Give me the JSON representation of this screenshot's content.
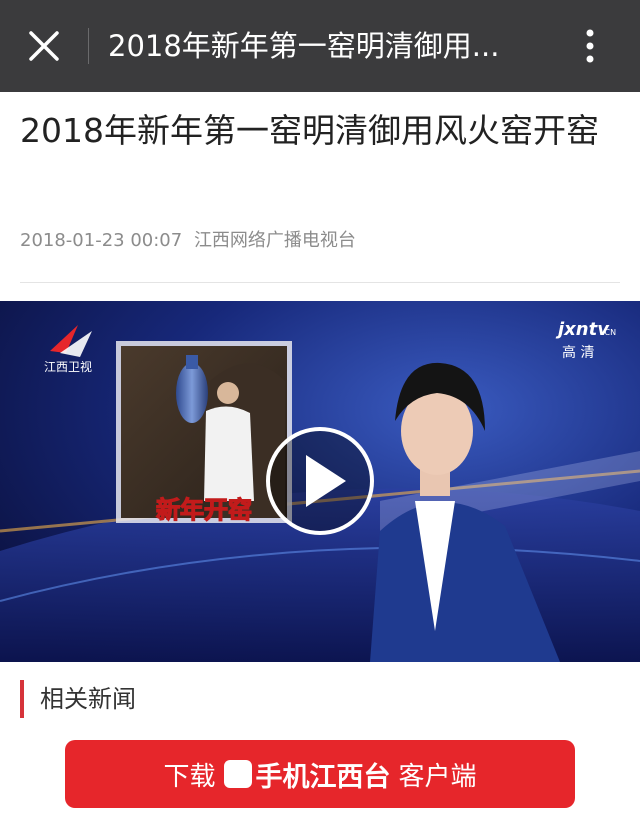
{
  "topbar": {
    "title": "2018年新年第一窑明清御用...",
    "close_icon": "close-icon",
    "more_icon": "more-vertical-icon"
  },
  "article": {
    "title": "2018年新年第一窑明清御用风火窑开窑",
    "date": "2018-01-23 00:07",
    "source": "江西网络广播电视台"
  },
  "video": {
    "caption": "新年开窑",
    "channel_logo_text": "江西卫视",
    "watermark": "jxntv",
    "watermark_suffix": ".CN",
    "hd_label": "高 清",
    "play_icon": "play-icon"
  },
  "related": {
    "heading": "相关新闻"
  },
  "download": {
    "prefix": "下载",
    "brand": "手机江西台",
    "suffix": "客户端"
  },
  "colors": {
    "topbar_bg": "#3b3b3d",
    "accent_red": "#e6262b",
    "related_bar": "#d6333a"
  }
}
